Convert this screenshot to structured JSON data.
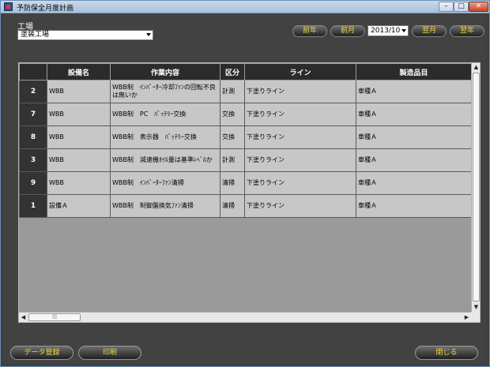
{
  "window": {
    "title": "予防保全月度計画",
    "minimize": "–",
    "maximize": "□",
    "close": "✕"
  },
  "filter": {
    "factory_label": "工場",
    "factory_value": "塗装工場"
  },
  "nav": {
    "prev_year": "前年",
    "prev_month": "前月",
    "month_value": "2013/10",
    "next_month": "翌月",
    "next_year": "翌年"
  },
  "table": {
    "columns": [
      "設備名",
      "作業内容",
      "区分",
      "ライン",
      "製造品目"
    ],
    "rows": [
      {
        "num": "2",
        "equipment": "WBB",
        "work": "WBB制　ｲﾝﾊﾞｰﾀｰ冷却ﾌｧﾝの回転不良は無いか",
        "category": "計測",
        "line": "下塗りライン",
        "product": "車種Ａ"
      },
      {
        "num": "7",
        "equipment": "WBB",
        "work": "WBB制　PC　ﾊﾞｯﾃﾘｰ交換",
        "category": "交換",
        "line": "下塗りライン",
        "product": "車種Ａ"
      },
      {
        "num": "8",
        "equipment": "WBB",
        "work": "WBB制　表示器　ﾊﾞｯﾃﾘｰ交換",
        "category": "交換",
        "line": "下塗りライン",
        "product": "車種Ａ"
      },
      {
        "num": "3",
        "equipment": "WBB",
        "work": "WBB制　減速機ｵｲﾙ量は基準ﾚﾍﾞﾙか",
        "category": "計測",
        "line": "下塗りライン",
        "product": "車種Ａ"
      },
      {
        "num": "9",
        "equipment": "WBB",
        "work": "WBB制　ｲﾝﾊﾞｰﾀｰﾌｧﾝ清掃",
        "category": "清掃",
        "line": "下塗りライン",
        "product": "車種Ａ"
      },
      {
        "num": "1",
        "equipment": "設備Ａ",
        "work": "WBB制　制御盤換気ﾌｧﾝ清掃",
        "category": "清掃",
        "line": "下塗りライン",
        "product": "車種Ａ"
      }
    ]
  },
  "scroll": {
    "up": "▲",
    "down": "▼",
    "left": "◀",
    "right": "▶",
    "grip": "|||"
  },
  "footer": {
    "register": "データ登録",
    "print": "印刷",
    "close": "閉じる"
  }
}
